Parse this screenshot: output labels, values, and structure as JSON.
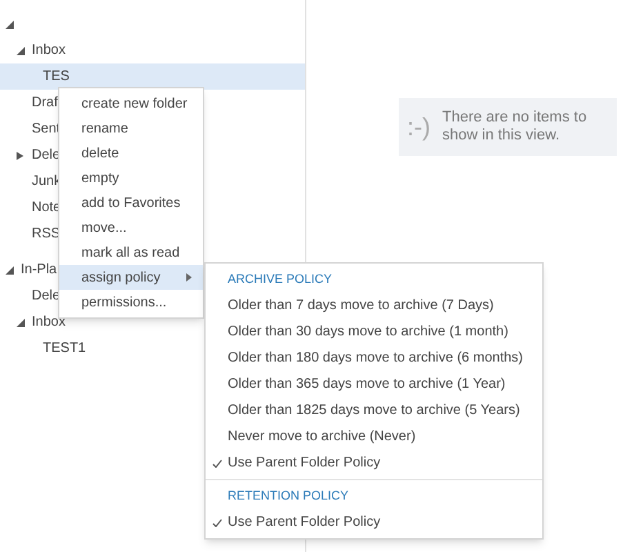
{
  "folders": [
    {
      "expanded": true,
      "selected": false,
      "children": [
        {
          "label": "Inbox",
          "expanded": true,
          "selected": false,
          "children": [
            {
              "label": "TES",
              "selected": true
            }
          ]
        },
        {
          "label": "Draf",
          "selected": false
        },
        {
          "label": "Sent",
          "selected": false
        },
        {
          "label": "Dele",
          "expanded": false,
          "selected": false
        },
        {
          "label": "Junk",
          "selected": false
        },
        {
          "label": "Note",
          "selected": false
        },
        {
          "label": "RSS",
          "selected": false
        }
      ]
    },
    {
      "label": "In-Pla",
      "expanded": true,
      "selected": false,
      "children": [
        {
          "label": "Dele",
          "selected": false
        },
        {
          "label": "Inbox",
          "expanded": true,
          "selected": false,
          "children": [
            {
              "label": "TEST1",
              "selected": false
            }
          ]
        }
      ]
    }
  ],
  "empty_view": {
    "emoticon": ":-)",
    "message": "There are no items to show in this view."
  },
  "context_menu": [
    {
      "label": "create new folder",
      "selected": false
    },
    {
      "label": "rename",
      "selected": false
    },
    {
      "label": "delete",
      "selected": false
    },
    {
      "label": "empty",
      "selected": false
    },
    {
      "label": "add to Favorites",
      "selected": false
    },
    {
      "label": "move...",
      "selected": false
    },
    {
      "label": "mark all as read",
      "selected": false
    },
    {
      "label": "assign policy",
      "selected": true,
      "submenu": true
    },
    {
      "label": "permissions...",
      "selected": false
    }
  ],
  "submenu": [
    {
      "heading": "ARCHIVE POLICY",
      "items": [
        {
          "label": "Older than 7 days move to archive (7 Days)",
          "checked": false
        },
        {
          "label": "Older than 30 days move to archive (1 month)",
          "checked": false
        },
        {
          "label": "Older than 180 days move to archive (6 months)",
          "checked": false
        },
        {
          "label": "Older than 365 days move to archive (1 Year)",
          "checked": false
        },
        {
          "label": "Older than 1825 days move to archive (5 Years)",
          "checked": false
        },
        {
          "label": "Never move to archive (Never)",
          "checked": false
        },
        {
          "label": "Use Parent Folder Policy",
          "checked": true
        }
      ]
    },
    {
      "heading": "RETENTION POLICY",
      "items": [
        {
          "label": "Use Parent Folder Policy",
          "checked": true
        }
      ]
    }
  ]
}
